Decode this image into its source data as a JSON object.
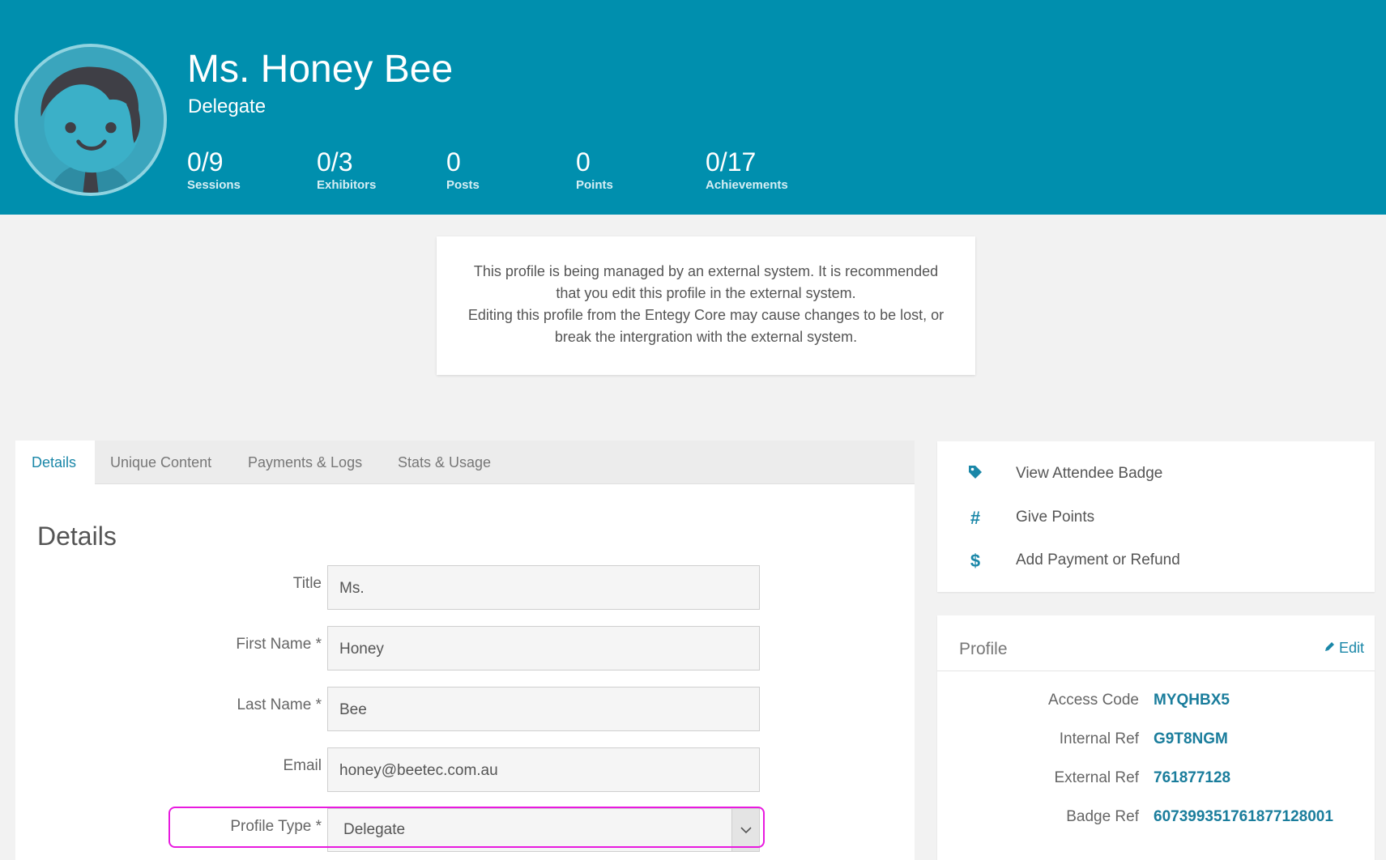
{
  "header": {
    "name": "Ms. Honey Bee",
    "role": "Delegate",
    "stats": [
      {
        "value": "0/9",
        "label": "Sessions"
      },
      {
        "value": "0/3",
        "label": "Exhibitors"
      },
      {
        "value": "0",
        "label": "Posts"
      },
      {
        "value": "0",
        "label": "Points"
      },
      {
        "value": "0/17",
        "label": "Achievements"
      }
    ]
  },
  "notice": {
    "line1": "This profile is being managed by an external system. It is recommended",
    "line2": "that you edit this profile in the external system.",
    "line3": "Editing this profile from the Entegy Core may cause changes to be lost, or",
    "line4": "break the intergration with the external system."
  },
  "tabs": [
    {
      "label": "Details"
    },
    {
      "label": "Unique Content"
    },
    {
      "label": "Payments & Logs"
    },
    {
      "label": "Stats & Usage"
    }
  ],
  "details": {
    "title": "Details",
    "fields": [
      {
        "label": "Title",
        "value": "Ms."
      },
      {
        "label": "First Name *",
        "value": "Honey"
      },
      {
        "label": "Last Name *",
        "value": "Bee"
      },
      {
        "label": "Email",
        "value": "honey@beetec.com.au"
      }
    ],
    "profile_type": {
      "label": "Profile Type *",
      "value": "Delegate"
    }
  },
  "actions": [
    {
      "label": "View Attendee Badge",
      "icon": "tag-icon"
    },
    {
      "label": "Give Points",
      "icon": "hash-icon"
    },
    {
      "label": "Add Payment or Refund",
      "icon": "dollar-icon"
    }
  ],
  "profile": {
    "title": "Profile",
    "edit_label": "Edit",
    "rows": [
      {
        "key": "Access Code",
        "value": "MYQHBX5"
      },
      {
        "key": "Internal Ref",
        "value": "G9T8NGM"
      },
      {
        "key": "External Ref",
        "value": "761877128"
      },
      {
        "key": "Badge Ref",
        "value": "607399351761877128001"
      }
    ]
  },
  "colors": {
    "header_bg": "#008fae",
    "accent": "#1a87a8",
    "highlight": "#e81adf"
  }
}
